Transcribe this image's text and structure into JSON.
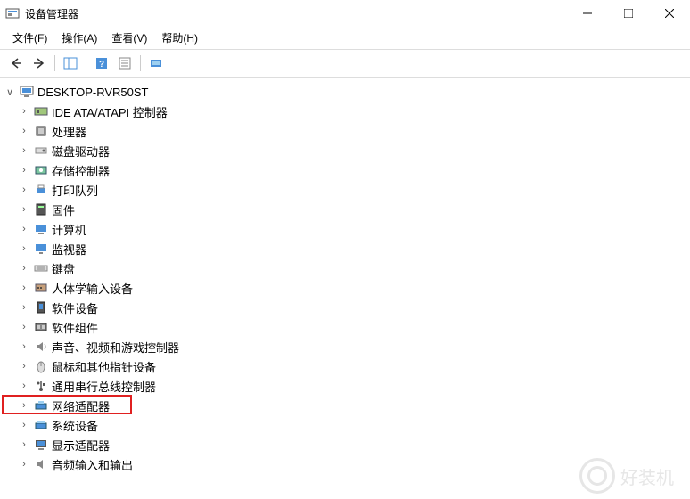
{
  "window_title": "设备管理器",
  "menus": {
    "file": {
      "label": "文件(F)"
    },
    "action": {
      "label": "操作(A)"
    },
    "view": {
      "label": "查看(V)"
    },
    "help": {
      "label": "帮助(H)"
    }
  },
  "tree": {
    "root_label": "DESKTOP-RVR50ST",
    "items": [
      {
        "label": "IDE ATA/ATAPI 控制器",
        "icon": "ide"
      },
      {
        "label": "处理器",
        "icon": "cpu"
      },
      {
        "label": "磁盘驱动器",
        "icon": "disk"
      },
      {
        "label": "存储控制器",
        "icon": "storage"
      },
      {
        "label": "打印队列",
        "icon": "printer"
      },
      {
        "label": "固件",
        "icon": "firmware"
      },
      {
        "label": "计算机",
        "icon": "computer"
      },
      {
        "label": "监视器",
        "icon": "monitor"
      },
      {
        "label": "键盘",
        "icon": "keyboard"
      },
      {
        "label": "人体学输入设备",
        "icon": "hid"
      },
      {
        "label": "软件设备",
        "icon": "softdev"
      },
      {
        "label": "软件组件",
        "icon": "softcomp"
      },
      {
        "label": "声音、视频和游戏控制器",
        "icon": "sound"
      },
      {
        "label": "鼠标和其他指针设备",
        "icon": "mouse"
      },
      {
        "label": "通用串行总线控制器",
        "icon": "usb"
      },
      {
        "label": "网络适配器",
        "icon": "network",
        "highlighted": true
      },
      {
        "label": "系统设备",
        "icon": "system"
      },
      {
        "label": "显示适配器",
        "icon": "display"
      },
      {
        "label": "音频输入和输出",
        "icon": "audio"
      }
    ]
  },
  "watermark_text": "好装机"
}
